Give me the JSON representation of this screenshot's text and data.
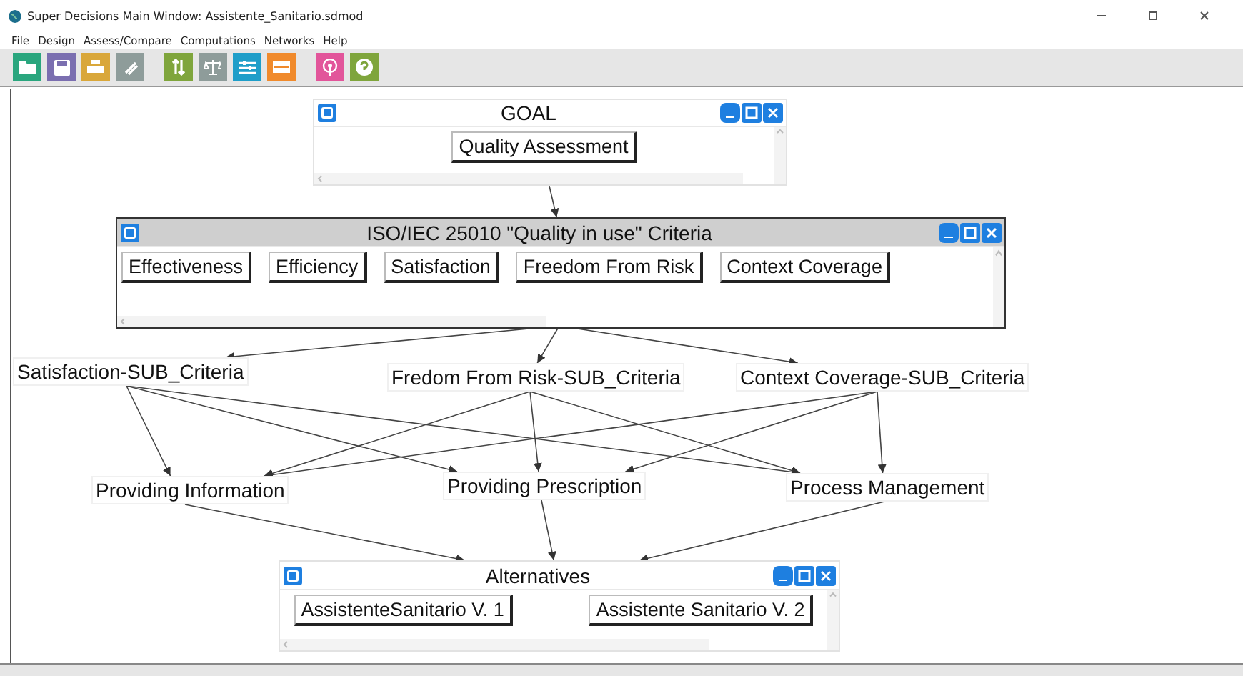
{
  "window": {
    "title": "Super Decisions Main Window: Assistente_Sanitario.sdmod"
  },
  "menu": [
    "File",
    "Design",
    "Assess/Compare",
    "Computations",
    "Networks",
    "Help"
  ],
  "toolbar": [
    [
      {
        "kind": "folder",
        "color": "#2aa67e"
      },
      {
        "kind": "save",
        "color": "#7b6fb0"
      },
      {
        "kind": "print",
        "color": "#d9a73a"
      },
      {
        "kind": "clip",
        "color": "#8e9c9a"
      }
    ],
    [
      {
        "kind": "cycle",
        "color": "#7fa53c"
      },
      {
        "kind": "scale",
        "color": "#8e9c9a"
      },
      {
        "kind": "sliders",
        "color": "#1f9ec9"
      },
      {
        "kind": "matrix",
        "color": "#f08a2c"
      }
    ],
    [
      {
        "kind": "broadcast",
        "color": "#e2559a"
      },
      {
        "kind": "help",
        "color": "#7fa53c"
      }
    ]
  ],
  "clusters": [
    {
      "title": "GOAL",
      "shaded": false,
      "nodes": [
        "Quality Assessment"
      ]
    },
    {
      "title": "ISO/IEC 25010 \"Quality in use\" Criteria",
      "shaded": true,
      "nodes": [
        "Effectiveness",
        "Efficiency",
        "Satisfaction",
        "Freedom From Risk",
        "Context Coverage"
      ]
    },
    {
      "title": "Alternatives",
      "shaded": false,
      "nodes": [
        "AssistenteSanitario V. 1",
        "Assistente Sanitario V. 2"
      ]
    }
  ],
  "labels": [
    "Satisfaction-SUB_Criteria",
    "Fredom From Risk-SUB_Criteria",
    "Context Coverage-SUB_Criteria",
    "Providing Information",
    "Providing Prescription",
    "Process Management"
  ]
}
